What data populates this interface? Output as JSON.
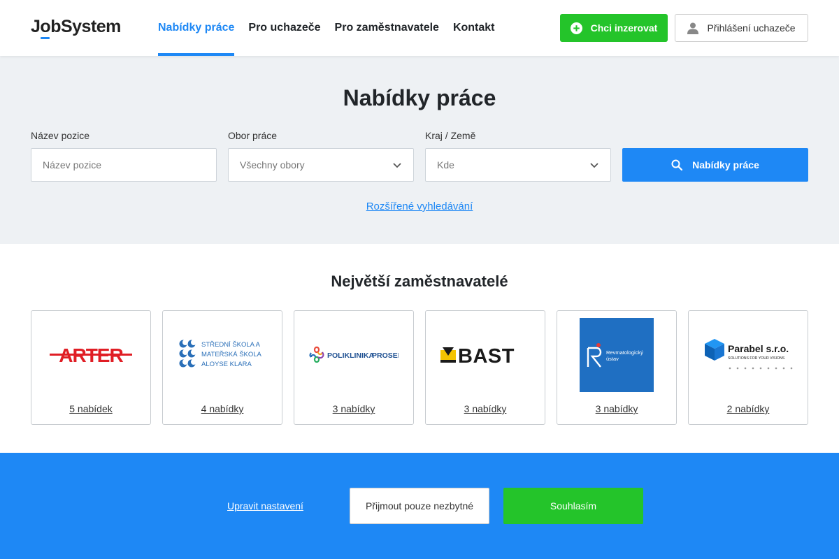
{
  "header": {
    "logo": {
      "part1": "J",
      "part2": "o",
      "part3": "bSystem"
    },
    "nav": [
      {
        "label": "Nabídky práce",
        "active": true
      },
      {
        "label": "Pro uchazeče",
        "active": false
      },
      {
        "label": "Pro zaměstnavatele",
        "active": false
      },
      {
        "label": "Kontakt",
        "active": false
      }
    ],
    "advertise_label": "Chci inzerovat",
    "login_label": "Přihlášení uchazeče"
  },
  "search": {
    "title": "Nabídky práce",
    "position": {
      "label": "Název pozice",
      "placeholder": "Název pozice"
    },
    "field": {
      "label": "Obor práce",
      "value": "Všechny obory"
    },
    "region": {
      "label": "Kraj / Země",
      "placeholder": "Kde"
    },
    "submit_label": "Nabídky práce",
    "advanced_link": "Rozšířené vyhledávání"
  },
  "employers": {
    "title": "Největší zaměstnavatelé",
    "items": [
      {
        "name": "ARTER",
        "count": "5 nabídek"
      },
      {
        "name": "Střední škola a mateřská škola Aloyse Klara",
        "logo_lines": [
          "STŘEDNÍ ŠKOLA A",
          "MATEŘSKÁ ŠKOLA",
          "ALOYSE KLARA"
        ],
        "count": "4 nabídky"
      },
      {
        "name": "Poliklinika Prosek",
        "logo_text_a": "POLIKLINIKA",
        "logo_text_b": "PROSEK",
        "count": "3 nabídky"
      },
      {
        "name": "BAST",
        "count": "3 nabídky"
      },
      {
        "name": "Revmatologický ústav",
        "logo_lines": [
          "Revmatologický",
          "ústav"
        ],
        "count": "3 nabídky"
      },
      {
        "name": "Parabel s.r.o.",
        "logo_tagline": "SOLUTIONS FOR YOUR VISIONS",
        "count": "2 nabídky"
      }
    ]
  },
  "cookies": {
    "settings_link": "Upravit nastavení",
    "necessary_label": "Přijmout pouze nezbytné",
    "agree_label": "Souhlasím"
  },
  "colors": {
    "accent": "#1e88f5",
    "green": "#24c42a",
    "search_bg": "#eef1f4",
    "text": "#212529"
  }
}
